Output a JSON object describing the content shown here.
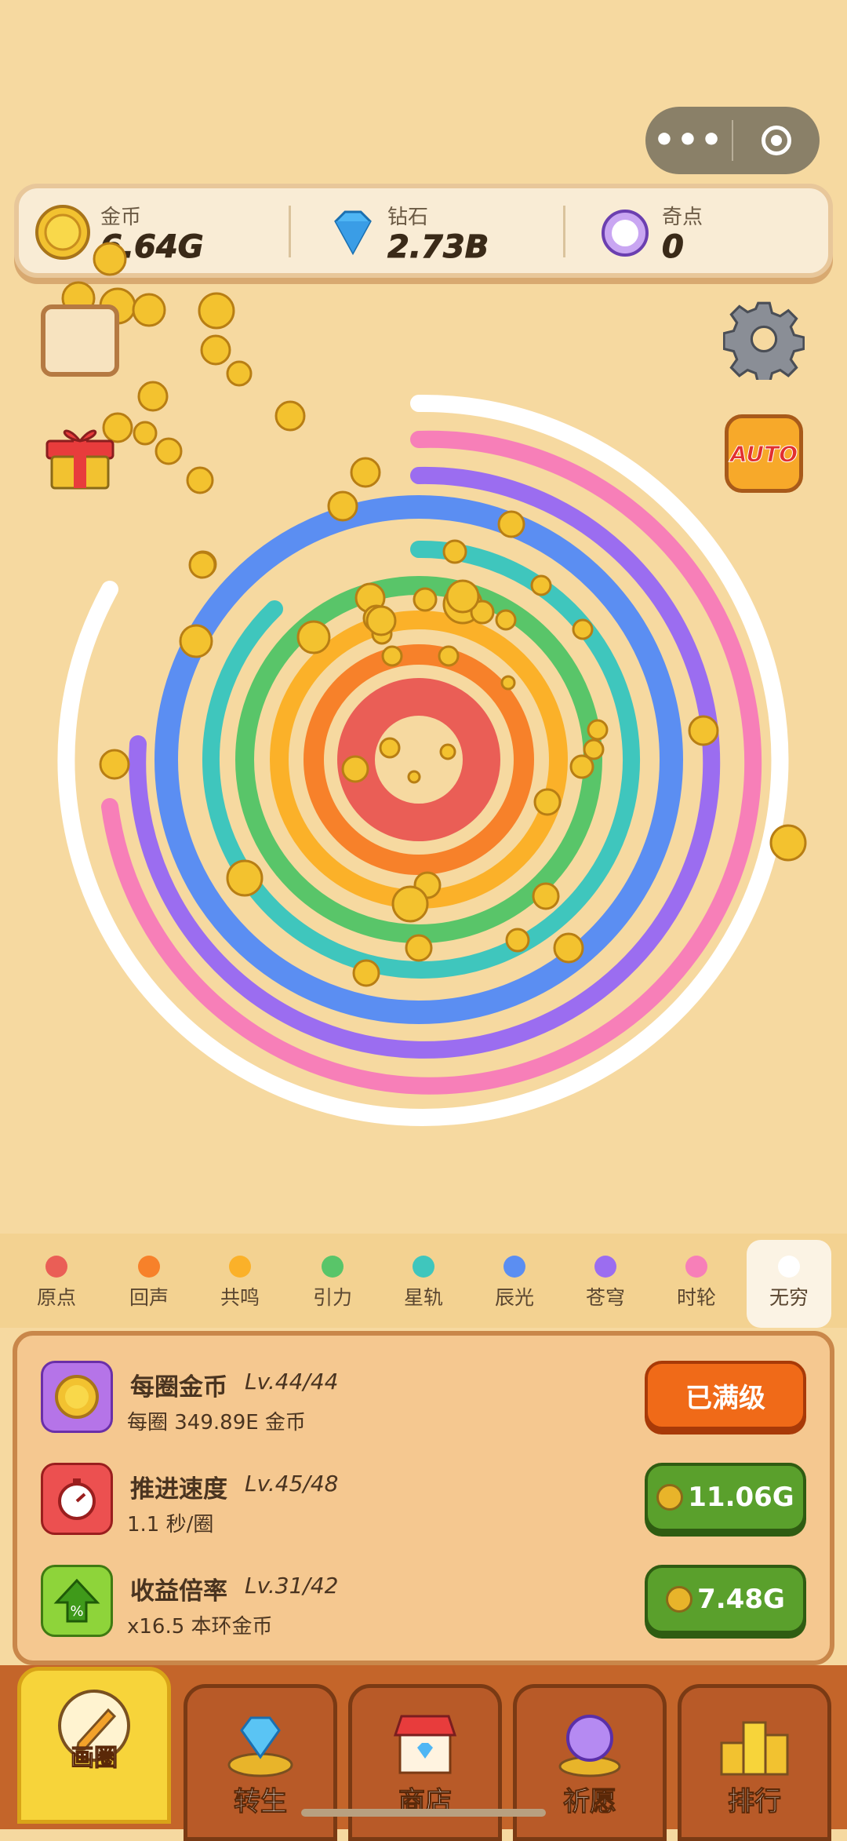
{
  "menu_capsule": {
    "more": "•••"
  },
  "resources": {
    "gold": {
      "label": "金币",
      "value": "6.64G"
    },
    "diamond": {
      "label": "钻石",
      "value": "2.73B"
    },
    "qidian": {
      "label": "奇点",
      "value": "0"
    }
  },
  "auto_label": "AUTO",
  "colors": {
    "ring1": "#ea5e56",
    "ring2": "#f7812a",
    "ring3": "#fbb129",
    "ring4": "#59c569",
    "ring5": "#3fc6bd",
    "ring6": "#5b8ef2",
    "ring7": "#9b6df0",
    "ring8": "#f77fb8",
    "ring9": "#ffffff"
  },
  "tabs": [
    {
      "label": "原点",
      "color": "#ea5e56"
    },
    {
      "label": "回声",
      "color": "#f7812a"
    },
    {
      "label": "共鸣",
      "color": "#fbb129"
    },
    {
      "label": "引力",
      "color": "#59c569"
    },
    {
      "label": "星轨",
      "color": "#3fc6bd"
    },
    {
      "label": "辰光",
      "color": "#5b8ef2"
    },
    {
      "label": "苍穹",
      "color": "#9b6df0"
    },
    {
      "label": "时轮",
      "color": "#f77fb8"
    },
    {
      "label": "无穷",
      "color": "#ffffff"
    }
  ],
  "upgrades": [
    {
      "name": "每圈金币",
      "level": "Lv.44/44",
      "desc": "每圈 349.89E 金币",
      "button": "已满级",
      "icon": "coin-icon"
    },
    {
      "name": "推进速度",
      "level": "Lv.45/48",
      "desc": "1.1 秒/圈",
      "button": "11.06G",
      "icon": "stopwatch-icon"
    },
    {
      "name": "收益倍率",
      "level": "Lv.31/42",
      "desc": "x16.5 本环金币",
      "button": "7.48G",
      "icon": "percent-arrow-icon"
    }
  ],
  "nav": [
    {
      "label": "画圈",
      "icon": "pencil-icon"
    },
    {
      "label": "转生",
      "icon": "diamond-pedestal-icon"
    },
    {
      "label": "商店",
      "icon": "shop-icon"
    },
    {
      "label": "祈愿",
      "icon": "orb-icon"
    },
    {
      "label": "排行",
      "icon": "podium-icon"
    }
  ]
}
